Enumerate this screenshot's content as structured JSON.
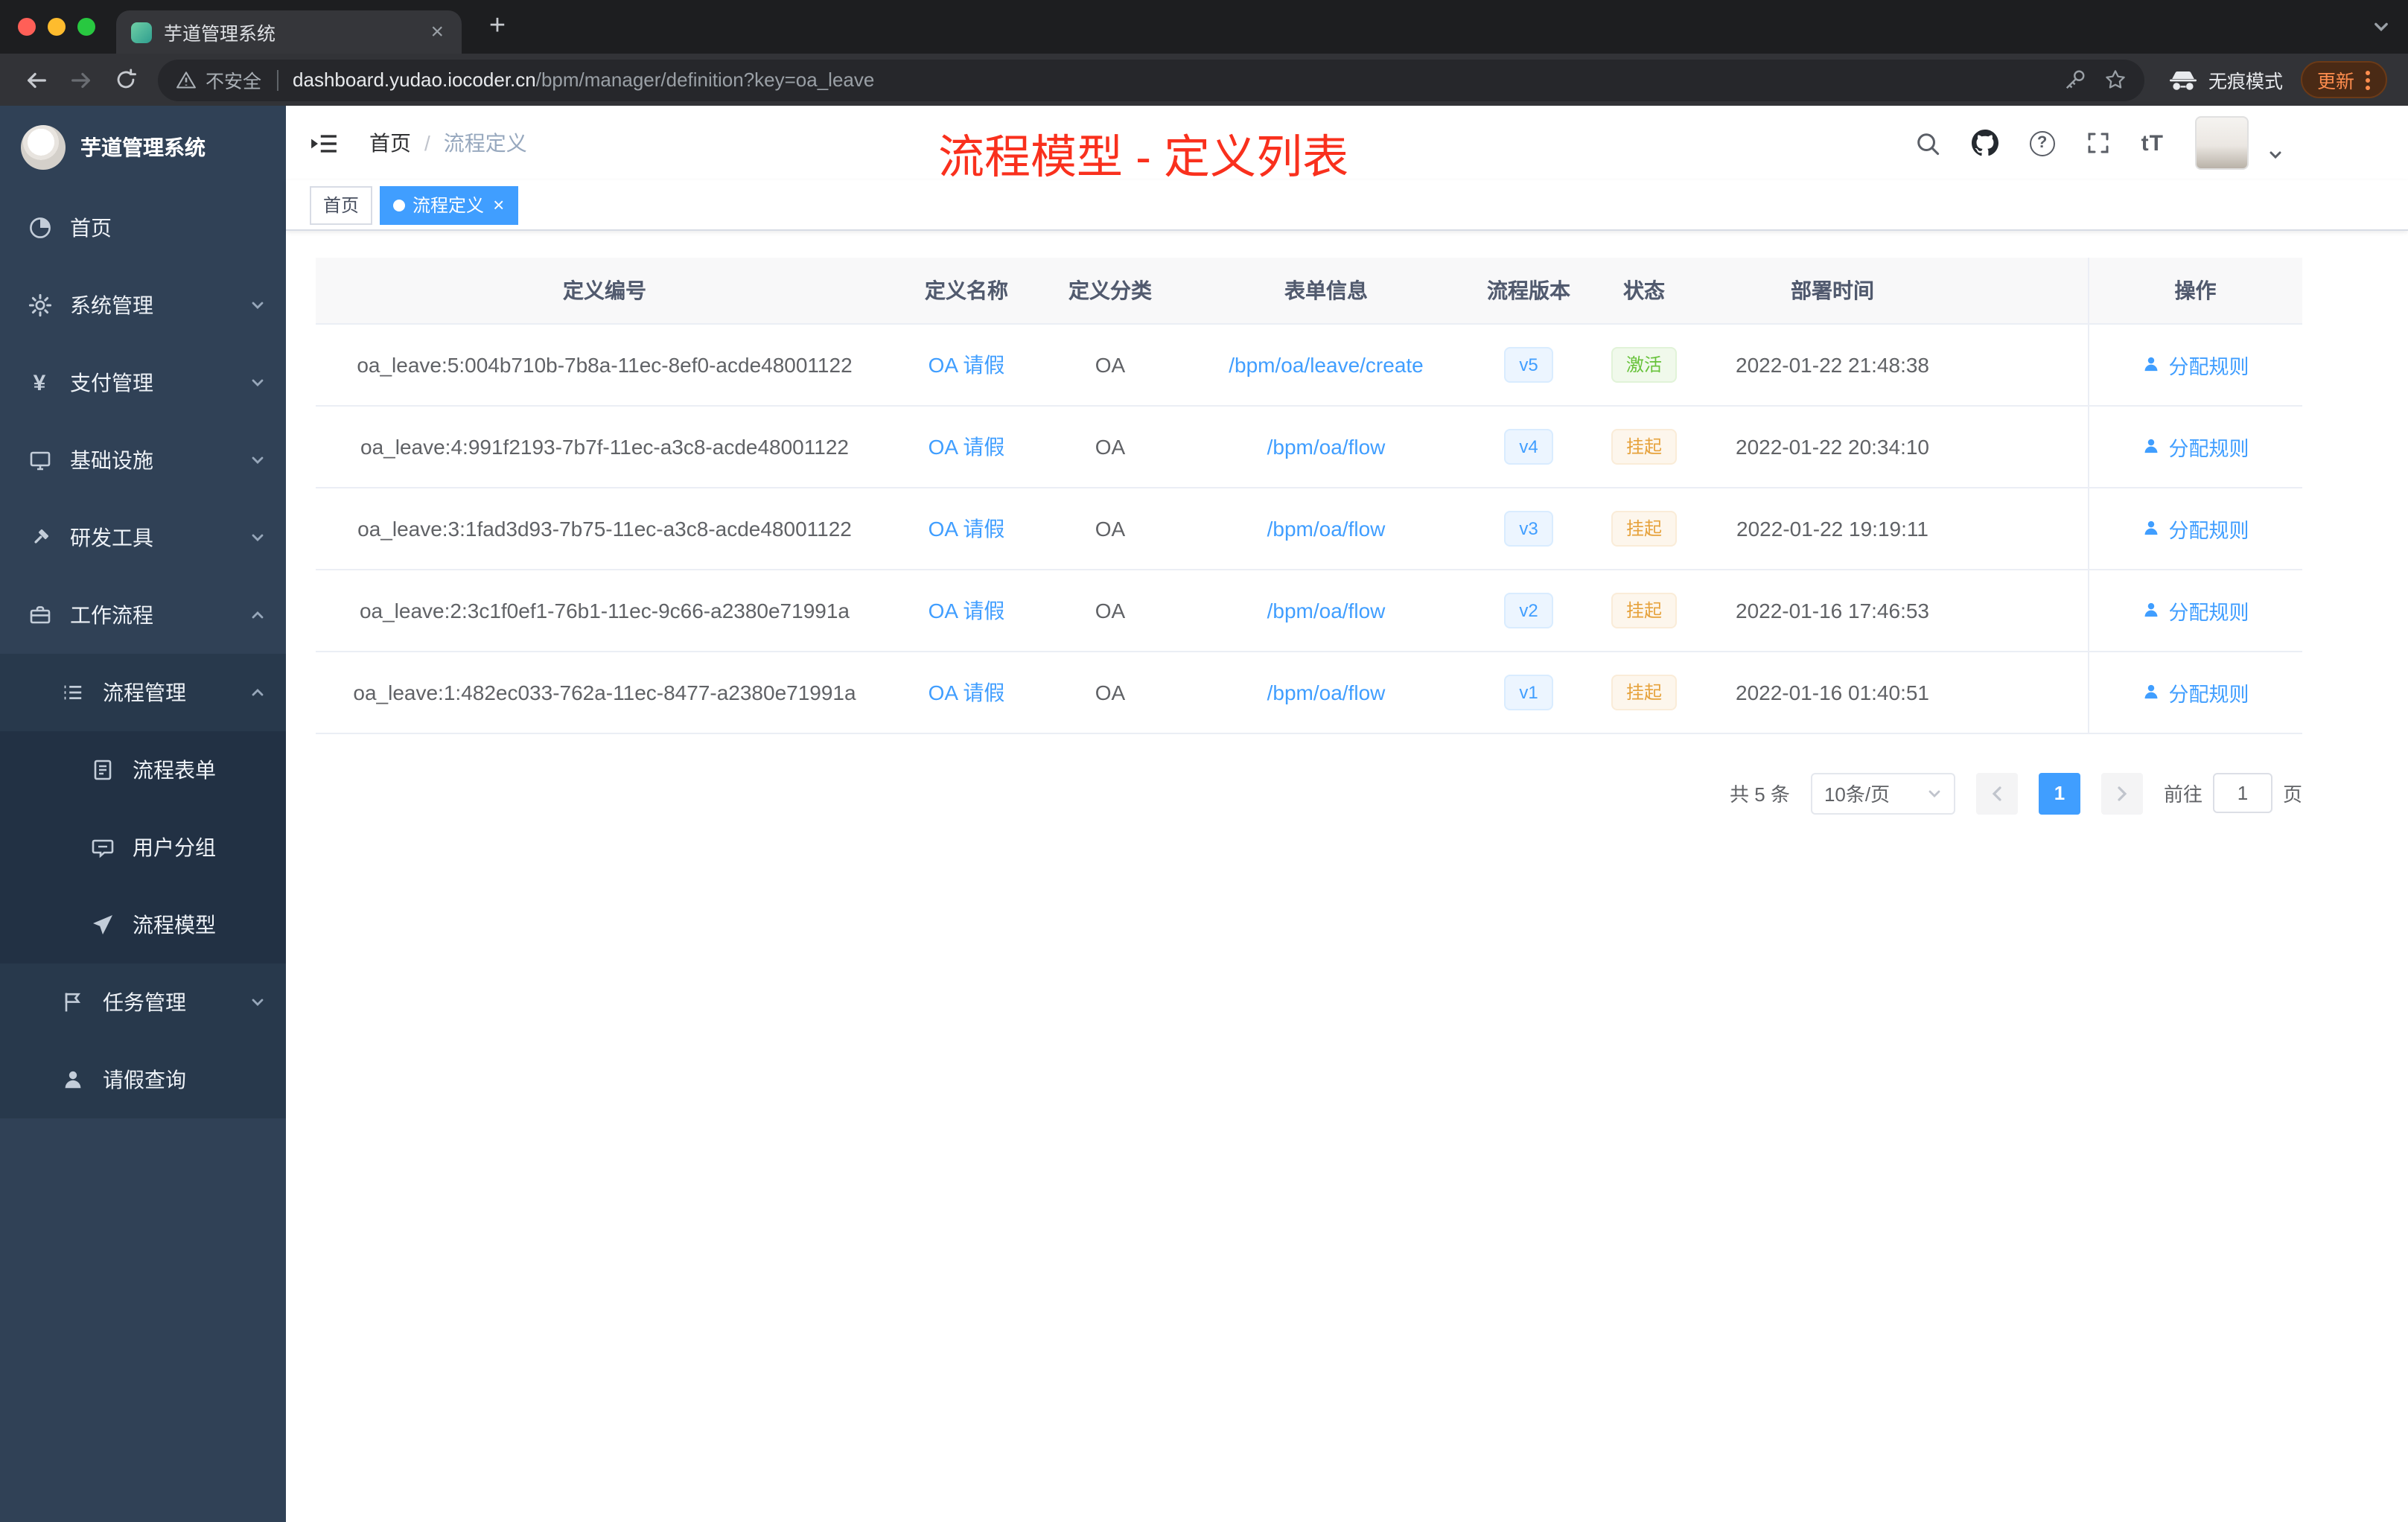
{
  "colors": {
    "accent": "#409eff",
    "red-note": "#f9301d",
    "success": "#67c23a",
    "success-bg": "#f0f9eb",
    "warning": "#e6a23c",
    "warning-bg": "#fdf6ec",
    "sidebar-bg": "#304156",
    "update-orange": "#ff8d4e"
  },
  "browser": {
    "tab_title": "芋道管理系统",
    "not_secure": "不安全",
    "url_domain": "dashboard.yudao.iocoder.cn",
    "url_path": "/bpm/manager/definition?key=oa_leave",
    "incognito": "无痕模式",
    "update": "更新"
  },
  "sidebar": {
    "title": "芋道管理系统",
    "home": "首页",
    "system": "系统管理",
    "pay": "支付管理",
    "infra": "基础设施",
    "dev": "研发工具",
    "flow": "工作流程",
    "flow_mgmt": "流程管理",
    "flow_form": "流程表单",
    "user_group": "用户分组",
    "flow_model": "流程模型",
    "task_mgmt": "任务管理",
    "leave": "请假查询"
  },
  "header": {
    "breadcrumb_home": "首页",
    "breadcrumb_sep": "/",
    "breadcrumb_current": "流程定义",
    "annotation": "流程模型 - 定义列表"
  },
  "tags": {
    "home": "首页",
    "current": "流程定义"
  },
  "table": {
    "columns": [
      "定义编号",
      "定义名称",
      "定义分类",
      "表单信息",
      "流程版本",
      "状态",
      "部署时间",
      "操作"
    ],
    "rows": [
      {
        "id": "oa_leave:5:004b710b-7b8a-11ec-8ef0-acde48001122",
        "name": "OA 请假",
        "category": "OA",
        "form": "/bpm/oa/leave/create",
        "version": "v5",
        "status": "激活",
        "time": "2022-01-22 21:48:38",
        "action": "分配规则"
      },
      {
        "id": "oa_leave:4:991f2193-7b7f-11ec-a3c8-acde48001122",
        "name": "OA 请假",
        "category": "OA",
        "form": "/bpm/oa/flow",
        "version": "v4",
        "status": "挂起",
        "time": "2022-01-22 20:34:10",
        "action": "分配规则"
      },
      {
        "id": "oa_leave:3:1fad3d93-7b75-11ec-a3c8-acde48001122",
        "name": "OA 请假",
        "category": "OA",
        "form": "/bpm/oa/flow",
        "version": "v3",
        "status": "挂起",
        "time": "2022-01-22 19:19:11",
        "action": "分配规则"
      },
      {
        "id": "oa_leave:2:3c1f0ef1-76b1-11ec-9c66-a2380e71991a",
        "name": "OA 请假",
        "category": "OA",
        "form": "/bpm/oa/flow",
        "version": "v2",
        "status": "挂起",
        "time": "2022-01-16 17:46:53",
        "action": "分配规则"
      },
      {
        "id": "oa_leave:1:482ec033-762a-11ec-8477-a2380e71991a",
        "name": "OA 请假",
        "category": "OA",
        "form": "/bpm/oa/flow",
        "version": "v1",
        "status": "挂起",
        "time": "2022-01-16 01:40:51",
        "action": "分配规则"
      }
    ]
  },
  "pagination": {
    "total": "共 5 条",
    "size": "10条/页",
    "page": "1",
    "goto": "前往",
    "unit": "页",
    "value": "1"
  }
}
